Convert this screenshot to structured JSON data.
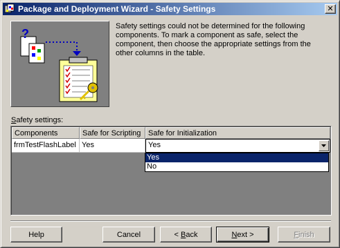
{
  "window": {
    "title": "Package and Deployment Wizard - Safety Settings",
    "close_label": "✕"
  },
  "description": "Safety settings could not be determined for the following components. To mark a component as safe, select the component, then choose the appropriate settings from the other columns in the table.",
  "safety_label_prefix": "S",
  "safety_label_rest": "afety settings:",
  "grid": {
    "headers": [
      "Components",
      "Safe for Scripting",
      "Safe for Initialization"
    ],
    "rows": [
      {
        "component": "frmTestFlashLabel",
        "scripting": "Yes",
        "initialization": "Yes"
      }
    ]
  },
  "dropdown": {
    "options": [
      "Yes",
      "No"
    ],
    "selected": "Yes"
  },
  "buttons": {
    "help": "Help",
    "cancel": "Cancel",
    "back_prefix": "< ",
    "back_mnemonic": "B",
    "back_rest": "ack",
    "next_mnemonic": "N",
    "next_rest": "ext >",
    "finish_mnemonic": "F",
    "finish_rest": "inish"
  },
  "colors": {
    "title_gradient_start": "#0a246a",
    "title_gradient_end": "#a6caf0",
    "selection": "#0a246a",
    "face": "#d4d0c8"
  },
  "icons": [
    "wizard-app-icon",
    "close-icon",
    "component-clipboard-illustration",
    "dropdown-arrow-icon"
  ]
}
